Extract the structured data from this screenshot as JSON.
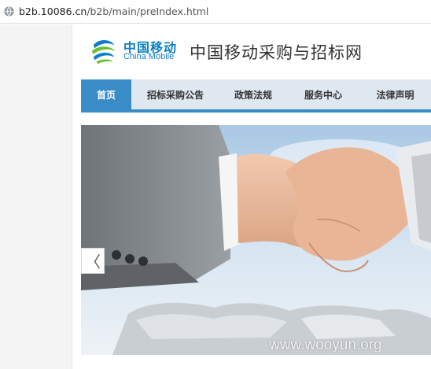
{
  "browser": {
    "url_host": "b2b.10086.cn",
    "url_path": "/b2b/main/preIndex.html"
  },
  "header": {
    "logo_cn": "中国移动",
    "logo_en": "China Mobile",
    "site_title": "中国移动采购与招标网"
  },
  "nav": {
    "items": [
      {
        "label": "首页",
        "active": true
      },
      {
        "label": "招标采购公告",
        "active": false
      },
      {
        "label": "政策法规",
        "active": false
      },
      {
        "label": "服务中心",
        "active": false
      },
      {
        "label": "法律声明",
        "active": false
      }
    ]
  },
  "banner": {
    "prev_label": "〈",
    "watermark": "www.wooyun.org"
  },
  "colors": {
    "accent": "#3a8cc7",
    "brand": "#0d7fc6"
  }
}
